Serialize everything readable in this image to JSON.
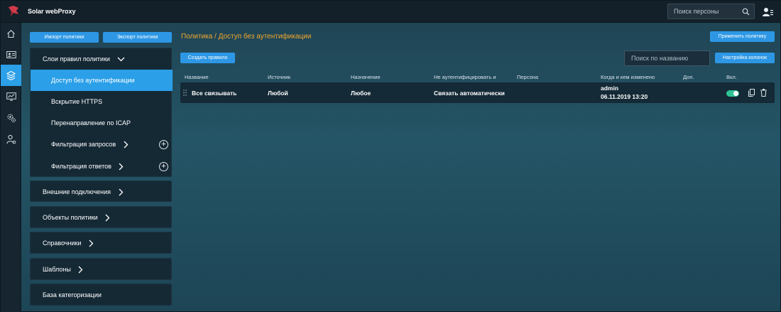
{
  "app": {
    "title": "Solar webProxy"
  },
  "topbar": {
    "search_placeholder": "Поиск персоны"
  },
  "left": {
    "import_label": "Импорт политики",
    "export_label": "Экспорт политики",
    "layers_header": "Слои правил политики",
    "layers": [
      {
        "label": "Доступ без аутентификации"
      },
      {
        "label": "Вскрытие HTTPS"
      },
      {
        "label": "Перенаправление по ICAP"
      },
      {
        "label": "Фильтрация запросов"
      },
      {
        "label": "Фильтрация ответов"
      }
    ],
    "sections": [
      {
        "label": "Внешние подключения"
      },
      {
        "label": "Объекты политики"
      },
      {
        "label": "Справочники"
      },
      {
        "label": "Шаблоны"
      },
      {
        "label": "База категоризации"
      }
    ]
  },
  "main": {
    "breadcrumb": "Политика / Доступ без аутентификации",
    "apply_label": "Применить политику",
    "create_label": "Создать правило",
    "search_placeholder": "Поиск по названию",
    "columns_label": "Настройка колонок",
    "columns": [
      "Название",
      "Источник",
      "Назначение",
      "Не аутентифицировать и",
      "Персона",
      "Когда и кем изменено",
      "Доп.",
      "Вкл."
    ],
    "rows": [
      {
        "name": "Все связывать",
        "source": "Любой",
        "destination": "Любое",
        "action": "Связать автоматически",
        "persona": "",
        "changed_by": "admin",
        "changed_at": "06.11.2019 13:20",
        "extra": "",
        "enabled": true
      }
    ]
  },
  "colors": {
    "accent": "#2b9fe8",
    "breadcrumb": "#f2a72c",
    "toggle_on": "#2fc394"
  }
}
